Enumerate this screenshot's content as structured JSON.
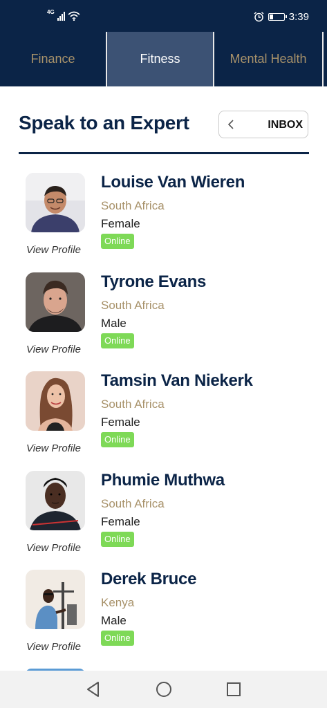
{
  "status_bar": {
    "network": "4G",
    "time": "3:39",
    "icons": [
      "signal-icon",
      "wifi-icon",
      "alarm-icon",
      "battery-icon"
    ]
  },
  "tabs": [
    {
      "label": "Finance",
      "active": false
    },
    {
      "label": "Fitness",
      "active": true
    },
    {
      "label": "Mental Health",
      "active": false
    }
  ],
  "header": {
    "title": "Speak to an Expert",
    "inbox_label": "INBOX"
  },
  "experts": [
    {
      "name": "Louise Van Wieren",
      "country": "South Africa",
      "gender": "Female",
      "status": "Online",
      "view_profile": "View Profile"
    },
    {
      "name": "Tyrone Evans",
      "country": "South Africa",
      "gender": "Male",
      "status": "Online",
      "view_profile": "View Profile"
    },
    {
      "name": "Tamsin Van Niekerk",
      "country": "South Africa",
      "gender": "Female",
      "status": "Online",
      "view_profile": "View Profile"
    },
    {
      "name": "Phumie Muthwa",
      "country": "South Africa",
      "gender": "Female",
      "status": "Online",
      "view_profile": "View Profile"
    },
    {
      "name": "Derek Bruce",
      "country": "Kenya",
      "gender": "Male",
      "status": "Online",
      "view_profile": "View Profile"
    }
  ],
  "colors": {
    "navy": "#0b2447",
    "active_tab": "#3c5274",
    "gold": "#a8926a",
    "online_green": "#7ed957"
  },
  "nav_bar": {
    "icons": [
      "back-icon",
      "home-icon",
      "recents-icon"
    ]
  }
}
